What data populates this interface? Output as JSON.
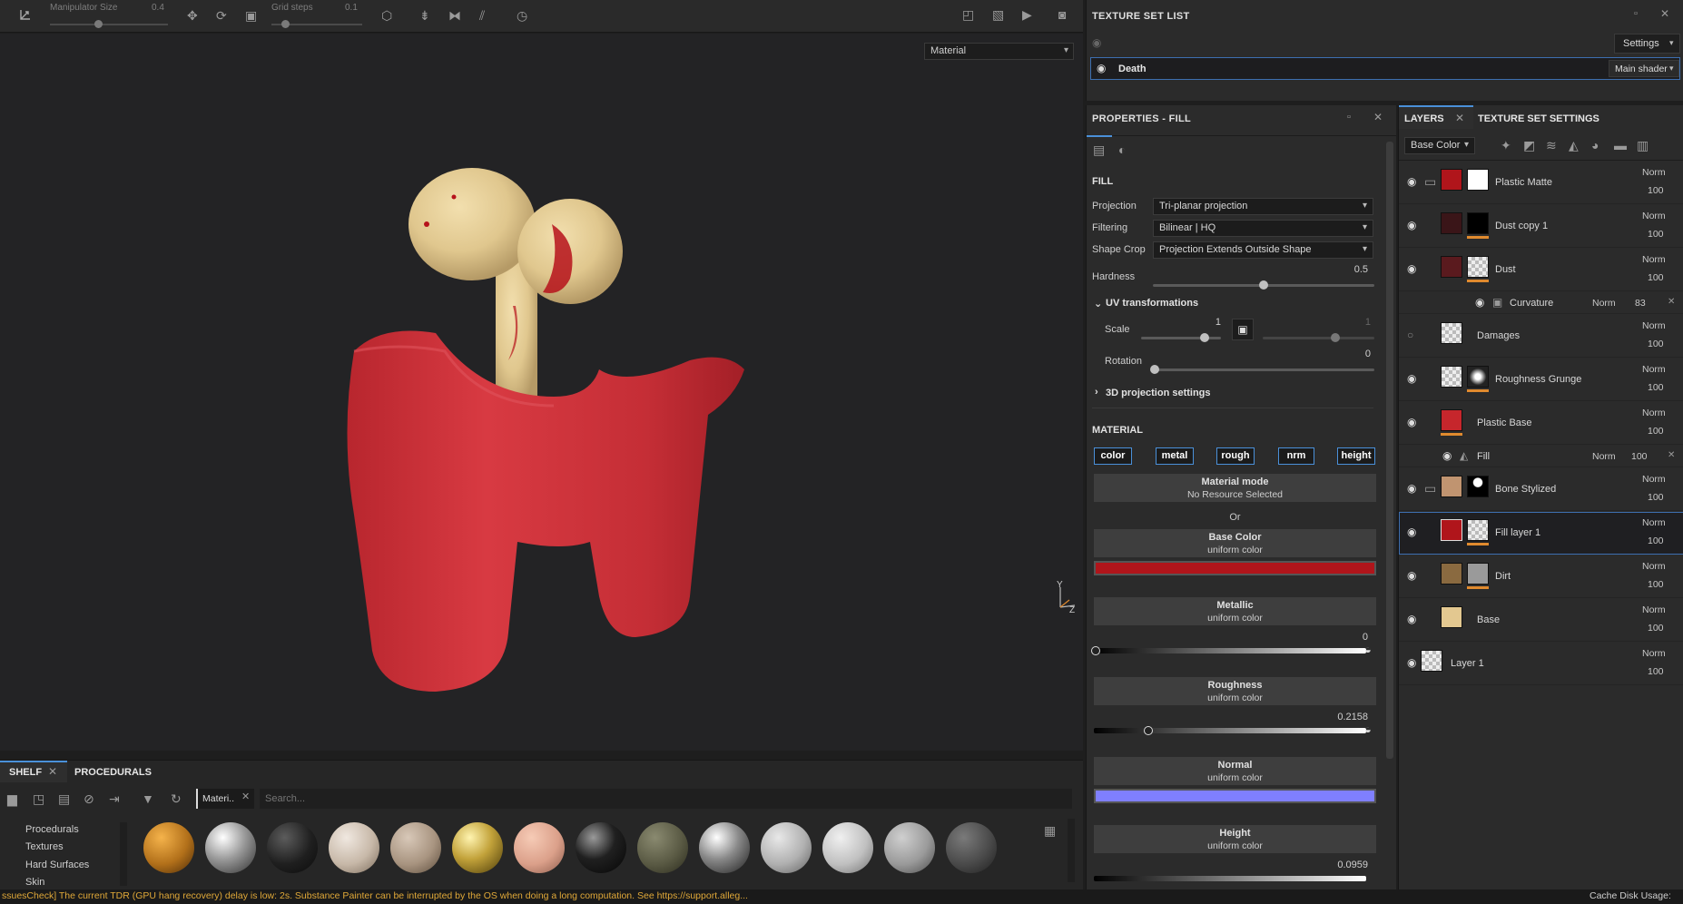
{
  "toolbar": {
    "manipulator_label": "Manipulator Size",
    "manipulator_value": "0.4",
    "grid_label": "Grid steps",
    "grid_value": "0.1"
  },
  "viewport": {
    "display_mode": "Material",
    "axis_y": "Y",
    "axis_z": "Z"
  },
  "texture_set_list": {
    "title": "TEXTURE SET LIST",
    "settings_btn": "Settings",
    "set_name": "Death",
    "shader": "Main shader"
  },
  "properties": {
    "title": "PROPERTIES - FILL",
    "fill_heading": "FILL",
    "projection_label": "Projection",
    "projection_value": "Tri-planar projection",
    "filtering_label": "Filtering",
    "filtering_value": "Bilinear | HQ",
    "shape_crop_label": "Shape Crop",
    "shape_crop_value": "Projection Extends Outside Shape",
    "hardness_label": "Hardness",
    "hardness_value": "0.5",
    "uv_heading": "UV transformations",
    "scale_label": "Scale",
    "scale_value": "1",
    "scale_value2": "1",
    "rotation_label": "Rotation",
    "rotation_value": "0",
    "projection_3d": "3D projection settings",
    "material_heading": "MATERIAL",
    "chips": [
      "color",
      "metal",
      "rough",
      "nrm",
      "height"
    ],
    "material_mode_title": "Material mode",
    "material_mode_sub": "No Resource Selected",
    "or_text": "Or",
    "base_color_title": "Base Color",
    "base_color_sub": "uniform color",
    "base_color_hex": "#b0151b",
    "metallic_title": "Metallic",
    "metallic_sub": "uniform color",
    "metallic_value": "0",
    "roughness_title": "Roughness",
    "roughness_sub": "uniform color",
    "roughness_value": "0.2158",
    "normal_title": "Normal",
    "normal_sub": "uniform color",
    "normal_hex": "#7f7fff",
    "height_title": "Height",
    "height_sub": "uniform color",
    "height_value": "0.0959"
  },
  "layers_panel": {
    "tab_layers": "LAYERS",
    "tab_tss": "TEXTURE SET SETTINGS",
    "channel": "Base Color",
    "layers": [
      {
        "name": "Plastic Matte",
        "blend": "Norm",
        "opacity": "100"
      },
      {
        "name": "Dust copy 1",
        "blend": "Norm",
        "opacity": "100"
      },
      {
        "name": "Dust",
        "blend": "Norm",
        "opacity": "100"
      },
      {
        "name": "Curvature",
        "blend": "Norm",
        "opacity": "83"
      },
      {
        "name": "Damages",
        "blend": "Norm",
        "opacity": "100"
      },
      {
        "name": "Roughness Grunge",
        "blend": "Norm",
        "opacity": "100"
      },
      {
        "name": "Plastic Base",
        "blend": "Norm",
        "opacity": "100"
      },
      {
        "name": "Fill",
        "blend": "Norm",
        "opacity": "100"
      },
      {
        "name": "Bone Stylized",
        "blend": "Norm",
        "opacity": "100"
      },
      {
        "name": "Fill layer 1",
        "blend": "Norm",
        "opacity": "100"
      },
      {
        "name": "Dirt",
        "blend": "Norm",
        "opacity": "100"
      },
      {
        "name": "Base",
        "blend": "Norm",
        "opacity": "100"
      },
      {
        "name": "Layer 1",
        "blend": "Norm",
        "opacity": "100"
      }
    ]
  },
  "shelf": {
    "tab_shelf": "SHELF",
    "tab_procedurals": "PROCEDURALS",
    "filter_chip": "Materi..",
    "search_placeholder": "Search...",
    "categories": [
      "Procedurals",
      "Textures",
      "Hard Surfaces",
      "Skin"
    ]
  },
  "status": {
    "message": "ssuesCheck] The current TDR (GPU hang recovery) delay is low: 2s. Substance Painter can be interrupted by the OS when doing a long computation. See https://support.alleg...",
    "cache": "Cache Disk Usage:"
  }
}
